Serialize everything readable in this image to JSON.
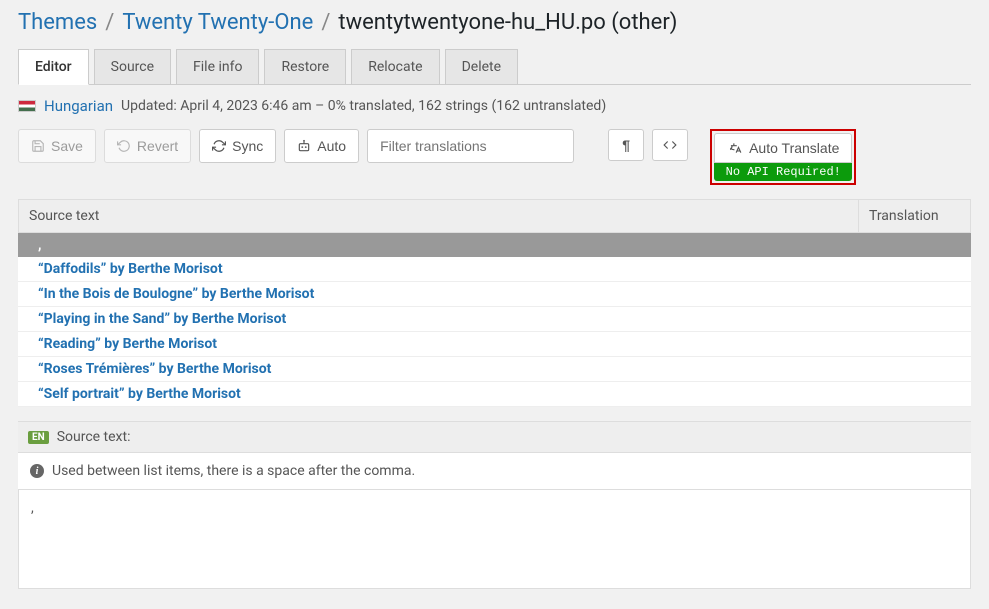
{
  "breadcrumb": {
    "themes": "Themes",
    "theme_name": "Twenty Twenty-One",
    "file": "twentytwentyone-hu_HU.po (other)"
  },
  "tabs": [
    {
      "id": "editor",
      "label": "Editor",
      "active": true
    },
    {
      "id": "source",
      "label": "Source",
      "active": false
    },
    {
      "id": "fileinfo",
      "label": "File info",
      "active": false
    },
    {
      "id": "restore",
      "label": "Restore",
      "active": false
    },
    {
      "id": "relocate",
      "label": "Relocate",
      "active": false
    },
    {
      "id": "delete",
      "label": "Delete",
      "active": false
    }
  ],
  "status": {
    "language": "Hungarian",
    "info": "Updated: April 4, 2023 6:46 am – 0% translated, 162 strings (162 untranslated)"
  },
  "toolbar": {
    "save": "Save",
    "revert": "Revert",
    "sync": "Sync",
    "auto": "Auto",
    "filter_placeholder": "Filter translations",
    "auto_translate": "Auto Translate",
    "no_api": "No API Required!"
  },
  "table": {
    "col_source": "Source text",
    "col_translation": "Translation",
    "selected": ",",
    "rows": [
      "“Daffodils” by Berthe Morisot",
      "“In the Bois de Boulogne” by Berthe Morisot",
      "“Playing in the Sand” by Berthe Morisot",
      "“Reading” by Berthe Morisot",
      "“Roses Trémières” by Berthe Morisot",
      "“Self portrait” by Berthe Morisot"
    ]
  },
  "source_panel": {
    "badge": "EN",
    "title": "Source text:",
    "hint": "Used between list items, there is a space after the comma.",
    "value": ","
  }
}
